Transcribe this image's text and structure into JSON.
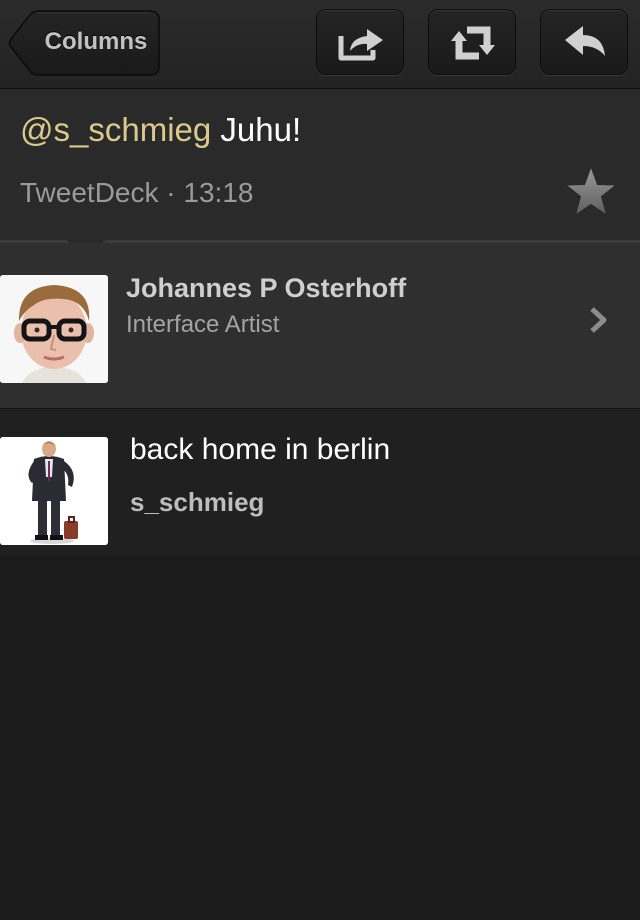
{
  "toolbar": {
    "back_label": "Columns",
    "actions": [
      {
        "name": "share",
        "icon": "share-icon"
      },
      {
        "name": "retweet",
        "icon": "retweet-icon"
      },
      {
        "name": "reply",
        "icon": "reply-icon"
      }
    ]
  },
  "tweet": {
    "mention": "@s_schmieg",
    "text": " Juhu!",
    "source": "TweetDeck",
    "separator": "·",
    "time": "13:18",
    "favorite_icon": "star-icon"
  },
  "author": {
    "name": "Johannes P Osterhoff",
    "bio": "Interface Artist",
    "avatar_icon": "avatar-photo",
    "disclosure_icon": "chevron-right-icon"
  },
  "in_reply_to": {
    "text": "back home in berlin",
    "username": "s_schmieg",
    "avatar_icon": "avatar-illustration"
  },
  "colors": {
    "mention": "#d9c98a",
    "background": "#1b1b1b",
    "panel": "#2a2a2a",
    "profile_row": "#2f2f2f"
  }
}
